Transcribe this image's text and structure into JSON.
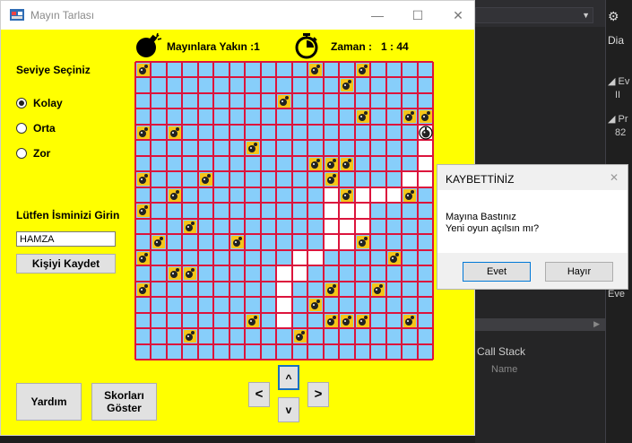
{
  "window": {
    "title": "Mayın Tarlası",
    "minimize": "—",
    "maximize": "☐",
    "close": "✕"
  },
  "header": {
    "near_mines_label": "Mayınlara Yakın :1",
    "time_label": "Zaman :",
    "time_value": "1 : 44"
  },
  "sidebar": {
    "level_title": "Seviye Seçiniz",
    "levels": [
      "Kolay",
      "Orta",
      "Zor"
    ],
    "selected_level": "Kolay",
    "name_prompt": "Lütfen İsminizi Girin",
    "name_value": "HAMZA",
    "save_button": "Kişiyi Kaydet"
  },
  "bottom": {
    "help_button": "Yardım",
    "scores_button": "Skorları Göster",
    "up": "^",
    "down": "v",
    "left": "<",
    "right": ">"
  },
  "board": {
    "rows": 19,
    "cols": 19,
    "mines": [
      [
        0,
        0
      ],
      [
        0,
        11
      ],
      [
        0,
        14
      ],
      [
        1,
        13
      ],
      [
        2,
        9
      ],
      [
        3,
        14
      ],
      [
        3,
        17
      ],
      [
        3,
        18
      ],
      [
        4,
        0
      ],
      [
        4,
        2
      ],
      [
        5,
        7
      ],
      [
        6,
        11
      ],
      [
        6,
        12
      ],
      [
        6,
        13
      ],
      [
        7,
        0
      ],
      [
        7,
        4
      ],
      [
        7,
        12
      ],
      [
        8,
        2
      ],
      [
        8,
        13
      ],
      [
        8,
        17
      ],
      [
        9,
        0
      ],
      [
        10,
        3
      ],
      [
        11,
        1
      ],
      [
        11,
        6
      ],
      [
        11,
        14
      ],
      [
        12,
        0
      ],
      [
        12,
        16
      ],
      [
        13,
        2
      ],
      [
        13,
        3
      ],
      [
        14,
        0
      ],
      [
        14,
        12
      ],
      [
        14,
        15
      ],
      [
        15,
        11
      ],
      [
        16,
        7
      ],
      [
        16,
        12
      ],
      [
        16,
        13
      ],
      [
        16,
        14
      ],
      [
        16,
        17
      ],
      [
        17,
        3
      ],
      [
        17,
        10
      ]
    ],
    "exploded": [
      [
        4,
        18
      ]
    ],
    "open": [
      [
        4,
        18
      ],
      [
        5,
        18
      ],
      [
        6,
        18
      ],
      [
        7,
        17
      ],
      [
        7,
        18
      ],
      [
        8,
        12
      ],
      [
        8,
        14
      ],
      [
        8,
        15
      ],
      [
        8,
        16
      ],
      [
        9,
        12
      ],
      [
        9,
        13
      ],
      [
        9,
        14
      ],
      [
        10,
        12
      ],
      [
        10,
        13
      ],
      [
        10,
        14
      ],
      [
        11,
        12
      ],
      [
        11,
        13
      ],
      [
        12,
        10
      ],
      [
        12,
        11
      ],
      [
        13,
        9
      ],
      [
        13,
        10
      ],
      [
        14,
        9
      ],
      [
        15,
        9
      ],
      [
        16,
        9
      ]
    ],
    "colors": {
      "closed": "#87cefa",
      "open": "#ffffff",
      "grid": "#dc143c",
      "mine_bg": "#f5c518"
    }
  },
  "dialog": {
    "title": "KAYBETTİNİZ",
    "close": "✕",
    "line1": "Mayına Bastınız",
    "line2": "Yeni oyun açılsın mı?",
    "yes": "Evet",
    "no": "Hayır"
  },
  "ide": {
    "gear": "⚙",
    "dia": "Dia",
    "ev": "◢ Ev",
    "ii": "II",
    "pr": "◢ Pr",
    "num": "82",
    "eve": "Eve",
    "call_stack": "Call Stack",
    "name_col": "Name"
  }
}
